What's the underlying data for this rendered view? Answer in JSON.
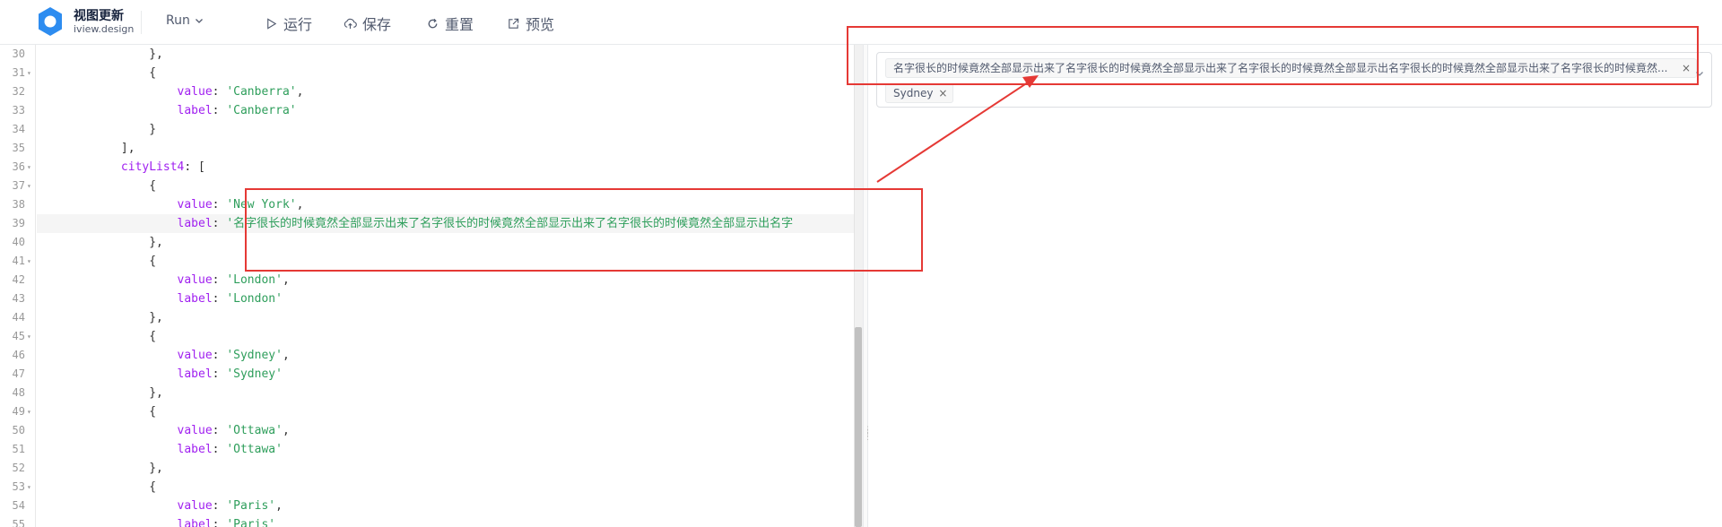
{
  "header": {
    "brand_title": "视图更新",
    "brand_sub": "iview.design",
    "run_label": "Run",
    "tools": [
      {
        "label": "运行",
        "icon": "play-icon"
      },
      {
        "label": "保存",
        "icon": "cloud-upload-icon"
      },
      {
        "label": "重置",
        "icon": "refresh-icon"
      },
      {
        "label": "预览",
        "icon": "external-link-icon"
      }
    ]
  },
  "editor": {
    "lines": [
      {
        "n": "30",
        "fold": false,
        "parts": [
          {
            "t": "p",
            "v": "                },"
          }
        ]
      },
      {
        "n": "31",
        "fold": true,
        "parts": [
          {
            "t": "p",
            "v": "                {"
          }
        ]
      },
      {
        "n": "32",
        "fold": false,
        "parts": [
          {
            "t": "k",
            "v": "                    value"
          },
          {
            "t": "p",
            "v": ": "
          },
          {
            "t": "s",
            "v": "'Canberra'"
          },
          {
            "t": "p",
            "v": ","
          }
        ]
      },
      {
        "n": "33",
        "fold": false,
        "parts": [
          {
            "t": "k",
            "v": "                    label"
          },
          {
            "t": "p",
            "v": ": "
          },
          {
            "t": "s",
            "v": "'Canberra'"
          }
        ]
      },
      {
        "n": "34",
        "fold": false,
        "parts": [
          {
            "t": "p",
            "v": "                }"
          }
        ]
      },
      {
        "n": "35",
        "fold": false,
        "parts": [
          {
            "t": "p",
            "v": "            ],"
          }
        ]
      },
      {
        "n": "36",
        "fold": true,
        "parts": [
          {
            "t": "k",
            "v": "            cityList4"
          },
          {
            "t": "p",
            "v": ": ["
          }
        ]
      },
      {
        "n": "37",
        "fold": true,
        "parts": [
          {
            "t": "p",
            "v": "                {"
          }
        ]
      },
      {
        "n": "38",
        "fold": false,
        "parts": [
          {
            "t": "k",
            "v": "                    value"
          },
          {
            "t": "p",
            "v": ": "
          },
          {
            "t": "s",
            "v": "'New York'"
          },
          {
            "t": "p",
            "v": ","
          }
        ]
      },
      {
        "n": "39",
        "fold": false,
        "active": true,
        "parts": [
          {
            "t": "k",
            "v": "                    label"
          },
          {
            "t": "p",
            "v": ": "
          },
          {
            "t": "s",
            "v": "'名字很长的时候竟然全部显示出来了名字很长的时候竟然全部显示出来了名字很长的时候竟然全部显示出名字"
          }
        ]
      },
      {
        "n": "40",
        "fold": false,
        "parts": [
          {
            "t": "p",
            "v": "                },"
          }
        ]
      },
      {
        "n": "41",
        "fold": true,
        "parts": [
          {
            "t": "p",
            "v": "                {"
          }
        ]
      },
      {
        "n": "42",
        "fold": false,
        "parts": [
          {
            "t": "k",
            "v": "                    value"
          },
          {
            "t": "p",
            "v": ": "
          },
          {
            "t": "s",
            "v": "'London'"
          },
          {
            "t": "p",
            "v": ","
          }
        ]
      },
      {
        "n": "43",
        "fold": false,
        "parts": [
          {
            "t": "k",
            "v": "                    label"
          },
          {
            "t": "p",
            "v": ": "
          },
          {
            "t": "s",
            "v": "'London'"
          }
        ]
      },
      {
        "n": "44",
        "fold": false,
        "parts": [
          {
            "t": "p",
            "v": "                },"
          }
        ]
      },
      {
        "n": "45",
        "fold": true,
        "parts": [
          {
            "t": "p",
            "v": "                {"
          }
        ]
      },
      {
        "n": "46",
        "fold": false,
        "parts": [
          {
            "t": "k",
            "v": "                    value"
          },
          {
            "t": "p",
            "v": ": "
          },
          {
            "t": "s",
            "v": "'Sydney'"
          },
          {
            "t": "p",
            "v": ","
          }
        ]
      },
      {
        "n": "47",
        "fold": false,
        "parts": [
          {
            "t": "k",
            "v": "                    label"
          },
          {
            "t": "p",
            "v": ": "
          },
          {
            "t": "s",
            "v": "'Sydney'"
          }
        ]
      },
      {
        "n": "48",
        "fold": false,
        "parts": [
          {
            "t": "p",
            "v": "                },"
          }
        ]
      },
      {
        "n": "49",
        "fold": true,
        "parts": [
          {
            "t": "p",
            "v": "                {"
          }
        ]
      },
      {
        "n": "50",
        "fold": false,
        "parts": [
          {
            "t": "k",
            "v": "                    value"
          },
          {
            "t": "p",
            "v": ": "
          },
          {
            "t": "s",
            "v": "'Ottawa'"
          },
          {
            "t": "p",
            "v": ","
          }
        ]
      },
      {
        "n": "51",
        "fold": false,
        "parts": [
          {
            "t": "k",
            "v": "                    label"
          },
          {
            "t": "p",
            "v": ": "
          },
          {
            "t": "s",
            "v": "'Ottawa'"
          }
        ]
      },
      {
        "n": "52",
        "fold": false,
        "parts": [
          {
            "t": "p",
            "v": "                },"
          }
        ]
      },
      {
        "n": "53",
        "fold": true,
        "parts": [
          {
            "t": "p",
            "v": "                {"
          }
        ]
      },
      {
        "n": "54",
        "fold": false,
        "parts": [
          {
            "t": "k",
            "v": "                    value"
          },
          {
            "t": "p",
            "v": ": "
          },
          {
            "t": "s",
            "v": "'Paris'"
          },
          {
            "t": "p",
            "v": ","
          }
        ]
      },
      {
        "n": "55",
        "fold": false,
        "parts": [
          {
            "t": "k",
            "v": "                    label"
          },
          {
            "t": "p",
            "v": ": "
          },
          {
            "t": "s",
            "v": "'Paris'"
          }
        ]
      }
    ]
  },
  "preview": {
    "tags": [
      {
        "label": "名字很长的时候竟然全部显示出来了名字很长的时候竟然全部显示出来了名字很长的时候竟然全部显示出名字很长的时候竟然全部显示出来了名字很长的时候竟然..."
      },
      {
        "label": "Sydney"
      }
    ],
    "close_glyph": "×"
  },
  "colors": {
    "annotation": "#e53935",
    "logo": "#2d8cf0",
    "keyword": "#a020f0",
    "string": "#2e9e5b"
  }
}
